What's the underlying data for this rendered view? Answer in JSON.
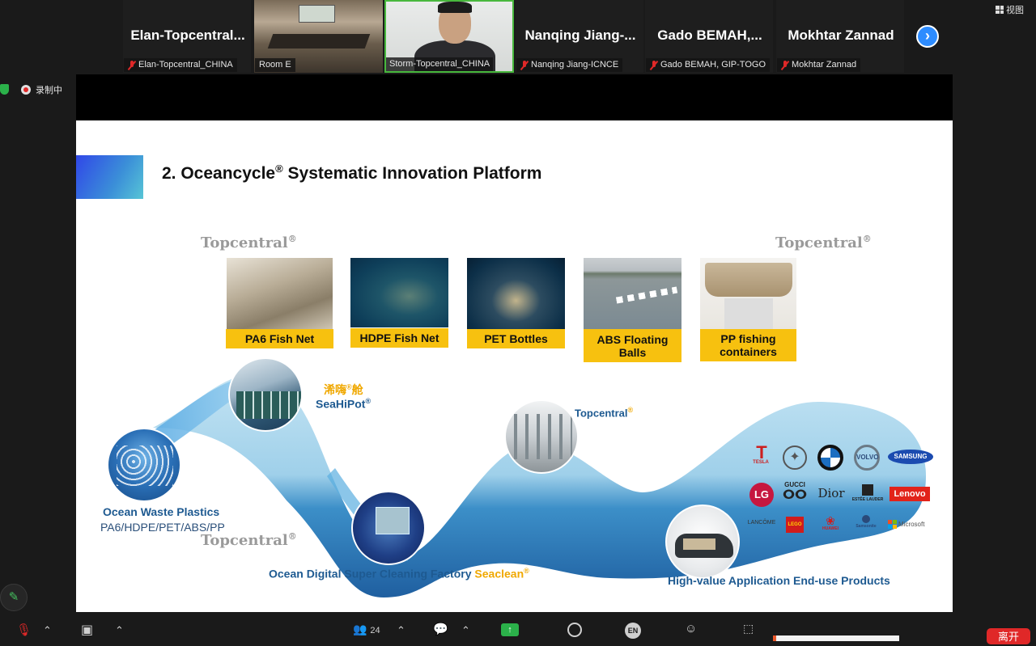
{
  "participants": [
    {
      "name": "Elan-Topcentral...",
      "tag": "Elan-Topcentral_CHINA",
      "muted": true
    },
    {
      "name": "",
      "tag": "Room E",
      "muted": false
    },
    {
      "name": "",
      "tag": "Storm-Topcentral_CHINA",
      "muted": false
    },
    {
      "name": "Nanqing  Jiang-...",
      "tag": "Nanqing Jiang-ICNCE",
      "muted": true
    },
    {
      "name": "Gado  BEMAH,...",
      "tag": "Gado BEMAH, GIP-TOGO",
      "muted": true
    },
    {
      "name": "Mokhtar Zannad",
      "tag": "Mokhtar Zannad",
      "muted": true
    }
  ],
  "top_right": {
    "view_label": "视图"
  },
  "recording": {
    "label": "录制中"
  },
  "slide": {
    "title": "2. Oceancycle",
    "title_reg": "®",
    "title_rest": " Systematic Innovation Platform",
    "brand": "Topcentral",
    "brand_reg": "®",
    "products": [
      {
        "label": "PA6 Fish Net"
      },
      {
        "label": "HDPE Fish Net"
      },
      {
        "label": "PET Bottles"
      },
      {
        "label": "ABS Floating Balls"
      },
      {
        "label": "PP fishing containers"
      }
    ],
    "seahipot_cn": "浠嗨",
    "seahipot_cn_reg": "®",
    "seahipot_cn_tail": "舱",
    "seahipot_en": "SeaHiPot",
    "topcentral_mid": "Topcentral",
    "ocean_waste_title": "Ocean Waste Plastics",
    "ocean_waste_types": "PA6/HDPE/PET/ABS/PP",
    "factory_label": "Ocean Digital Super Cleaning Factory ",
    "factory_brand": "Seaclean",
    "end_use_label": "High-value Application End-use Products",
    "brand_logos": [
      "TESLA",
      "Mercedes",
      "BMW",
      "VOLVO",
      "SAMSUNG",
      "LG",
      "GUCCI",
      "Dior",
      "ESTĒE LAUDER",
      "Lenovo",
      "LANCÔME",
      "LEGO",
      "HUAWEI",
      "Samsonite",
      "Microsoft"
    ]
  },
  "toolbar": {
    "participant_count": "24",
    "lang": "EN",
    "leave": "离开"
  },
  "colors": {
    "zoom_blue": "#2d8cff",
    "highlight_yellow": "#f7c10f",
    "leave_red": "#e02828",
    "active_green": "#48b83d"
  }
}
